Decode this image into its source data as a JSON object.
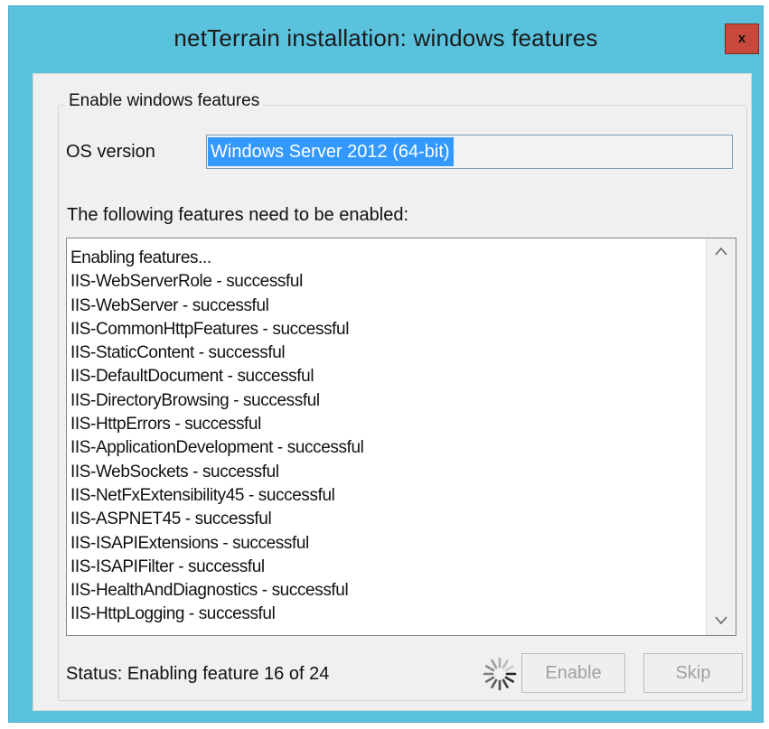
{
  "window": {
    "title": "netTerrain installation: windows features",
    "close_label": "x",
    "accent_color": "#5bc2dd",
    "close_color": "#c7493c"
  },
  "group": {
    "caption": "Enable windows features"
  },
  "os": {
    "label": "OS version",
    "value": "Windows Server 2012 (64-bit)"
  },
  "features": {
    "label": "The following features need to be enabled:",
    "log_lines": [
      "Enabling features...",
      "IIS-WebServerRole - successful",
      "IIS-WebServer - successful",
      "IIS-CommonHttpFeatures - successful",
      "IIS-StaticContent - successful",
      "IIS-DefaultDocument - successful",
      "IIS-DirectoryBrowsing - successful",
      "IIS-HttpErrors - successful",
      "IIS-ApplicationDevelopment - successful",
      "IIS-WebSockets - successful",
      "IIS-NetFxExtensibility45 - successful",
      "IIS-ASPNET45 - successful",
      "IIS-ISAPIExtensions - successful",
      "IIS-ISAPIFilter - successful",
      "IIS-HealthAndDiagnostics - successful",
      "IIS-HttpLogging - successful"
    ]
  },
  "status": {
    "text": "Status: Enabling feature 16 of 24",
    "spinner_icon": "loading-spinner-icon"
  },
  "buttons": {
    "enable_label": "Enable",
    "skip_label": "Skip"
  },
  "scrollbar": {
    "up_icon": "chevron-up-icon",
    "down_icon": "chevron-down-icon"
  }
}
